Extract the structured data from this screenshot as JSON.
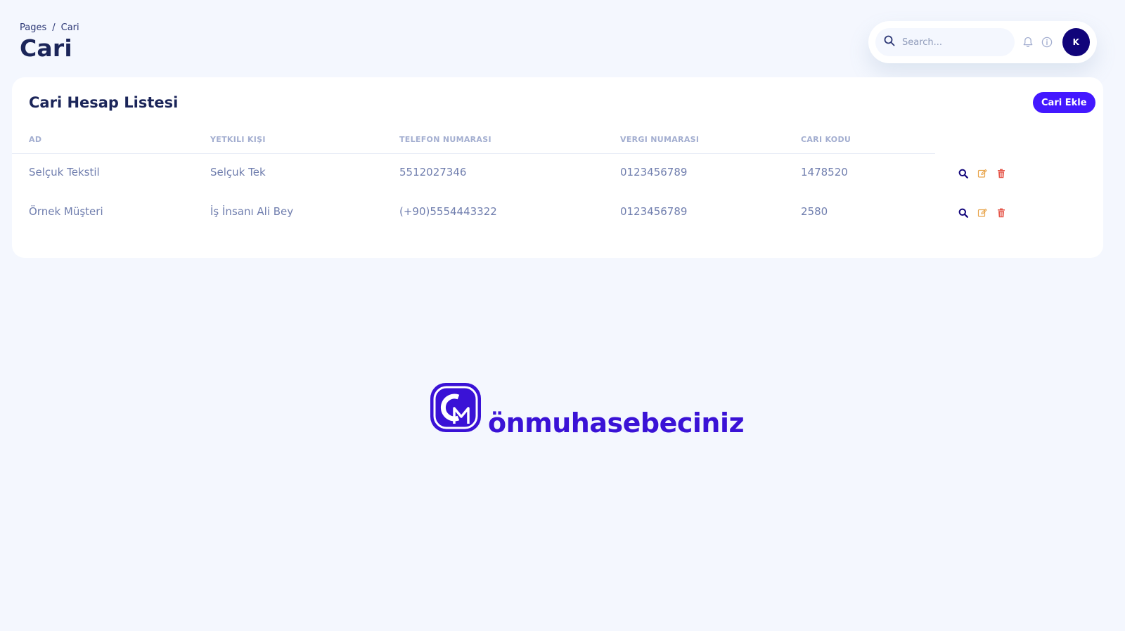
{
  "breadcrumb": {
    "root": "Pages",
    "separator": "/",
    "current": "Cari"
  },
  "page_title": "Cari",
  "topbar": {
    "search_placeholder": "Search...",
    "avatar_initial": "K"
  },
  "card": {
    "title": "Cari Hesap Listesi",
    "add_button_label": "Cari Ekle"
  },
  "table": {
    "columns": [
      "AD",
      "YETKILI KIŞI",
      "TELEFON NUMARASI",
      "VERGI NUMARASI",
      "CARI KODU"
    ],
    "rows": [
      [
        "Selçuk Tekstil",
        "Selçuk Tek",
        "5512027346",
        "0123456789",
        "1478520"
      ],
      [
        "Örnek Müşteri",
        "İş İnsanı Ali Bey",
        "(+90)5554443322",
        "0123456789",
        "2580"
      ]
    ]
  },
  "brand": {
    "name": "önmuhasebeciniz"
  },
  "colors": {
    "accent": "#4318ff",
    "brand": "#3a12d6",
    "avatar_bg": "#11047a",
    "edit_icon": "#e8a44a",
    "delete_icon": "#e5574b"
  },
  "icons": [
    "search-icon",
    "bell-icon",
    "info-icon",
    "view-icon",
    "edit-icon",
    "trash-icon"
  ]
}
